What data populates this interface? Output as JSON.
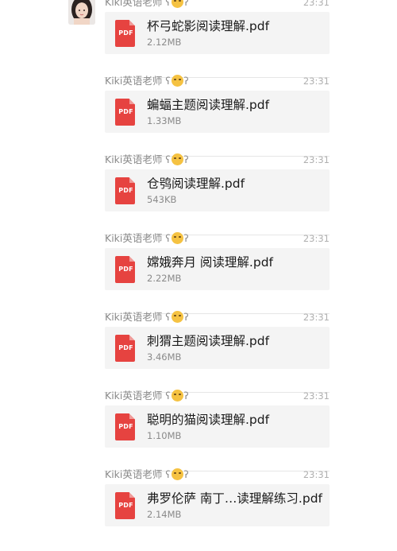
{
  "chat": {
    "items": [
      {
        "sender": "Kiki英语老师",
        "time": "23:31",
        "file_name": "杯弓蛇影阅读理解.pdf",
        "file_size": "2.12MB",
        "pdf_badge": "PDF"
      },
      {
        "sender": "Kiki英语老师",
        "time": "23:31",
        "file_name": "蝙蝠主题阅读理解.pdf",
        "file_size": "1.33MB",
        "pdf_badge": "PDF"
      },
      {
        "sender": "Kiki英语老师",
        "time": "23:31",
        "file_name": "仓鸮阅读理解.pdf",
        "file_size": "543KB",
        "pdf_badge": "PDF"
      },
      {
        "sender": "Kiki英语老师",
        "time": "23:31",
        "file_name": "嫦娥奔月 阅读理解.pdf",
        "file_size": "2.22MB",
        "pdf_badge": "PDF"
      },
      {
        "sender": "Kiki英语老师",
        "time": "23:31",
        "file_name": "刺猬主题阅读理解.pdf",
        "file_size": "3.46MB",
        "pdf_badge": "PDF"
      },
      {
        "sender": "Kiki英语老师",
        "time": "23:31",
        "file_name": "聪明的猫阅读理解.pdf",
        "file_size": "1.10MB",
        "pdf_badge": "PDF"
      },
      {
        "sender": "Kiki英语老师",
        "time": "23:31",
        "file_name": "弗罗伦萨 南丁…读理解练习.pdf",
        "file_size": "2.14MB",
        "pdf_badge": "PDF"
      }
    ]
  }
}
